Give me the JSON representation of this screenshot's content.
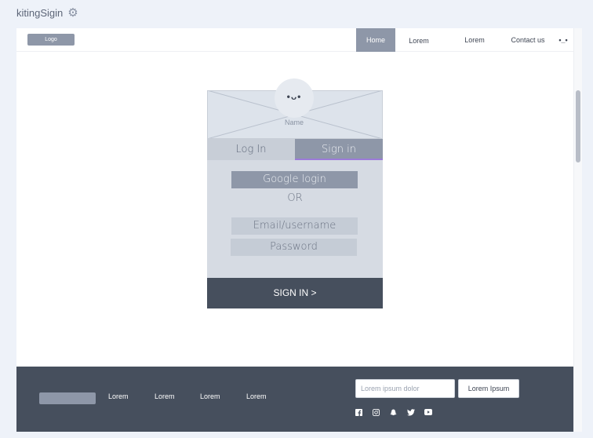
{
  "app": {
    "title": "kitingSigin",
    "settings_icon": "gear-icon"
  },
  "header": {
    "logo": "Logo",
    "nav": {
      "home": "Home",
      "lorem1": "Lorem",
      "lorem2": "Lorem",
      "contact": "Contact us",
      "more": "•_•"
    },
    "active": "Home"
  },
  "card": {
    "name_label": "Name",
    "face": "•ᴗ•",
    "tabs": {
      "login": "Log In",
      "signin": "Sign in"
    },
    "active_tab": "Sign in",
    "google_button": "Google login",
    "or_label": "OR",
    "email_placeholder": "Email/username",
    "password_placeholder": "Password",
    "submit_button": "SIGN IN >"
  },
  "footer": {
    "links": [
      "Lorem",
      "Lorem",
      "Lorem",
      "Lorem"
    ],
    "input_placeholder": "Lorem ipsum dolor",
    "button_label": "Lorem Ipsum",
    "social_icons": [
      "facebook-icon",
      "instagram-icon",
      "snapchat-icon",
      "twitter-icon",
      "youtube-icon"
    ]
  },
  "colors": {
    "accent": "#8e97a8",
    "dark": "#464f5d",
    "tab_underline": "#9b7bd8",
    "background": "#eef2f9"
  }
}
